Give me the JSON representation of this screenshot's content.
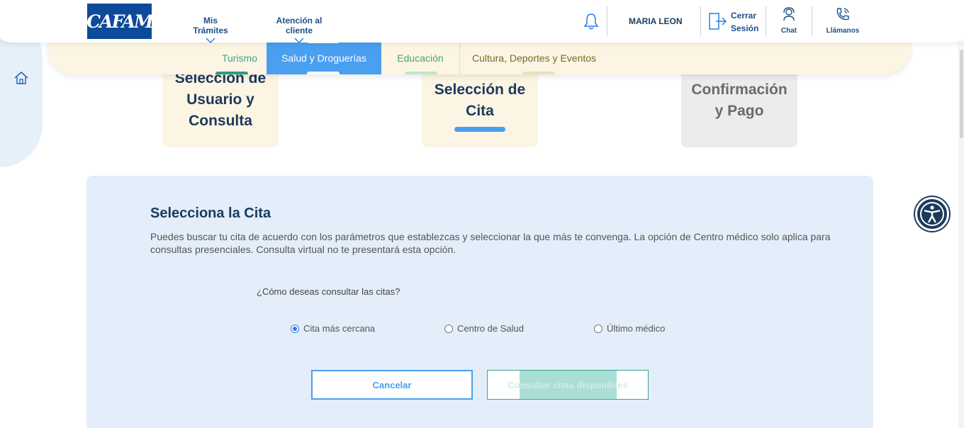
{
  "header": {
    "logo_text": "CAFAM",
    "nav": [
      {
        "label": "Mis Trámites"
      },
      {
        "label": "Atención al cliente"
      }
    ],
    "user_name": "MARIA LEON",
    "logout_line1": "Cerrar",
    "logout_line2": "Sesión",
    "chat_label": "Chat",
    "call_label": "Llámanos"
  },
  "categories": [
    {
      "label": "Turismo",
      "accent": "#3aa58f"
    },
    {
      "label": "Salud y Droguerías",
      "accent": "#4a9ff0",
      "active": true
    },
    {
      "label": "Educación",
      "accent": "#4aab5f"
    },
    {
      "label": "Cultura, Deportes y Eventos",
      "accent": "#7a6a22"
    }
  ],
  "steps": [
    {
      "title_line1": "Selección de",
      "title_line2": "Usuario y",
      "title_line3": "Consulta",
      "state": "done"
    },
    {
      "title_line1": "Selección de",
      "title_line2": "Cita",
      "state": "active"
    },
    {
      "title_line1": "Confirmación",
      "title_line2": "y Pago",
      "state": "pending"
    }
  ],
  "panel": {
    "title": "Selecciona la Cita",
    "description": "Puedes buscar tu cita de acuerdo con los parámetros que establezcas y seleccionar la que más te convenga. La opción de Centro médico solo aplica para consultas presenciales. Consulta virtual no te presentará esta opción.",
    "question": "¿Cómo deseas consultar las citas?",
    "options": [
      {
        "label": "Cita más cercana",
        "selected": true
      },
      {
        "label": "Centro de Salud",
        "selected": false
      },
      {
        "label": "Último médico",
        "selected": false
      }
    ],
    "cancel_label": "Cancelar",
    "consult_label": "Consultar citas disponibles"
  },
  "icons": {
    "home": "home-icon",
    "bell": "bell-icon",
    "logout": "logout-icon",
    "chat": "headset-icon",
    "call": "phone-icon",
    "accessibility": "accessibility-icon"
  },
  "colors": {
    "brand": "#0d4a9a",
    "primary": "#4a9ff0",
    "dark": "#1b3a5c",
    "panel_bg": "#e3eefa",
    "cream": "#fdf5e4"
  }
}
